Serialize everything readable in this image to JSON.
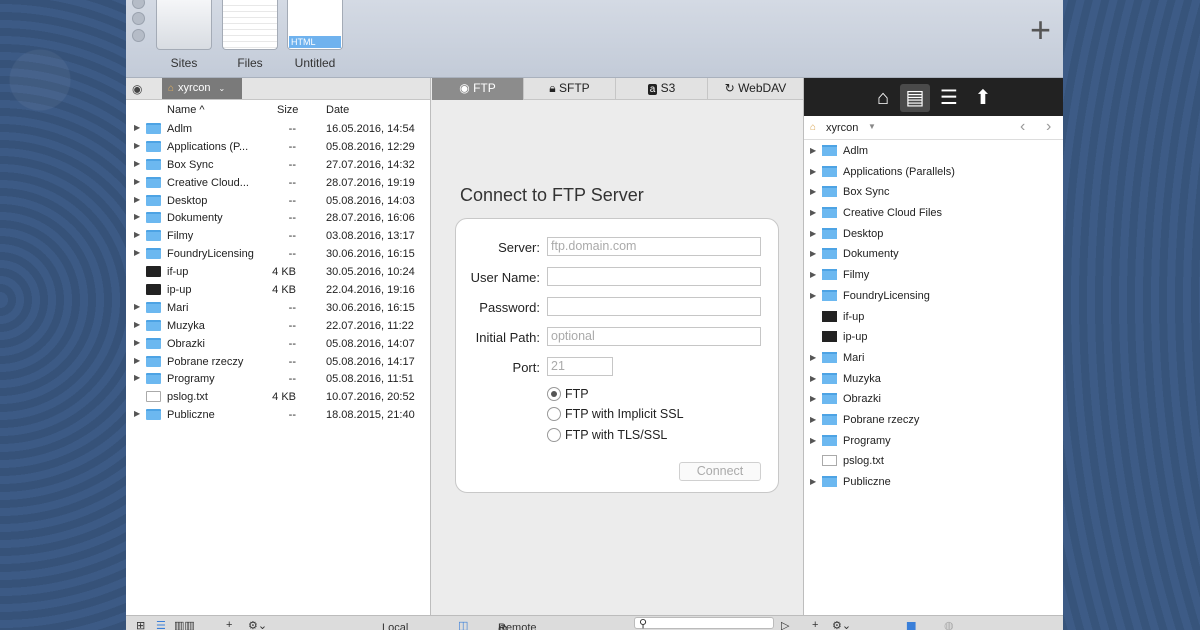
{
  "toolbar": {
    "items": [
      {
        "label": "Sites"
      },
      {
        "label": "Files"
      },
      {
        "label": "Untitled",
        "badge": "HTML"
      }
    ],
    "add_icon": "plus-icon"
  },
  "left": {
    "path": "xyrcon",
    "columns": {
      "name": "Name ^",
      "size": "Size",
      "date": "Date"
    },
    "files": [
      {
        "name": "Adlm",
        "size": "--",
        "date": "16.05.2016, 14:54",
        "type": "folder"
      },
      {
        "name": "Applications (P...",
        "size": "--",
        "date": "05.08.2016, 12:29",
        "type": "folder"
      },
      {
        "name": "Box Sync",
        "size": "--",
        "date": "27.07.2016, 14:32",
        "type": "folder"
      },
      {
        "name": "Creative Cloud...",
        "size": "--",
        "date": "28.07.2016, 19:19",
        "type": "folder"
      },
      {
        "name": "Desktop",
        "size": "--",
        "date": "05.08.2016, 14:03",
        "type": "folder"
      },
      {
        "name": "Dokumenty",
        "size": "--",
        "date": "28.07.2016, 16:06",
        "type": "folder"
      },
      {
        "name": "Filmy",
        "size": "--",
        "date": "03.08.2016, 13:17",
        "type": "folder"
      },
      {
        "name": "FoundryLicensing",
        "size": "--",
        "date": "30.06.2016, 16:15",
        "type": "folder"
      },
      {
        "name": "if-up",
        "size": "4 KB",
        "date": "30.05.2016, 10:24",
        "type": "term"
      },
      {
        "name": "ip-up",
        "size": "4 KB",
        "date": "22.04.2016, 19:16",
        "type": "term"
      },
      {
        "name": "Mari",
        "size": "--",
        "date": "30.06.2016, 16:15",
        "type": "folder"
      },
      {
        "name": "Muzyka",
        "size": "--",
        "date": "22.07.2016, 11:22",
        "type": "folder"
      },
      {
        "name": "Obrazki",
        "size": "--",
        "date": "05.08.2016, 14:07",
        "type": "folder"
      },
      {
        "name": "Pobrane rzeczy",
        "size": "--",
        "date": "05.08.2016, 14:17",
        "type": "folder"
      },
      {
        "name": "Programy",
        "size": "--",
        "date": "05.08.2016, 11:51",
        "type": "folder"
      },
      {
        "name": "pslog.txt",
        "size": "4 KB",
        "date": "10.07.2016, 20:52",
        "type": "doc"
      },
      {
        "name": "Publiczne",
        "size": "--",
        "date": "18.08.2015, 21:40",
        "type": "folder"
      }
    ]
  },
  "center": {
    "tabs": [
      "FTP",
      "SFTP",
      "S3",
      "WebDAV"
    ],
    "active_tab": "FTP",
    "title": "Connect to FTP Server",
    "form": {
      "server_label": "Server:",
      "server_placeholder": "ftp.domain.com",
      "username_label": "User Name:",
      "password_label": "Password:",
      "path_label": "Initial Path:",
      "path_placeholder": "optional",
      "port_label": "Port:",
      "port_placeholder": "21",
      "protocols": [
        "FTP",
        "FTP with Implicit SSL",
        "FTP with TLS/SSL"
      ],
      "selected_protocol": "FTP",
      "connect_label": "Connect"
    }
  },
  "right": {
    "path": "xyrcon",
    "files": [
      {
        "name": "Adlm",
        "type": "folder"
      },
      {
        "name": "Applications (Parallels)",
        "type": "folder"
      },
      {
        "name": "Box Sync",
        "type": "folder"
      },
      {
        "name": "Creative Cloud Files",
        "type": "folder"
      },
      {
        "name": "Desktop",
        "type": "folder"
      },
      {
        "name": "Dokumenty",
        "type": "folder"
      },
      {
        "name": "Filmy",
        "type": "folder"
      },
      {
        "name": "FoundryLicensing",
        "type": "folder"
      },
      {
        "name": "if-up",
        "type": "term"
      },
      {
        "name": "ip-up",
        "type": "term"
      },
      {
        "name": "Mari",
        "type": "folder"
      },
      {
        "name": "Muzyka",
        "type": "folder"
      },
      {
        "name": "Obrazki",
        "type": "folder"
      },
      {
        "name": "Pobrane rzeczy",
        "type": "folder"
      },
      {
        "name": "Programy",
        "type": "folder"
      },
      {
        "name": "pslog.txt",
        "type": "doc"
      },
      {
        "name": "Publiczne",
        "type": "folder"
      }
    ]
  },
  "statusbar": {
    "local_label": "Local",
    "remote_label": "Remote"
  }
}
